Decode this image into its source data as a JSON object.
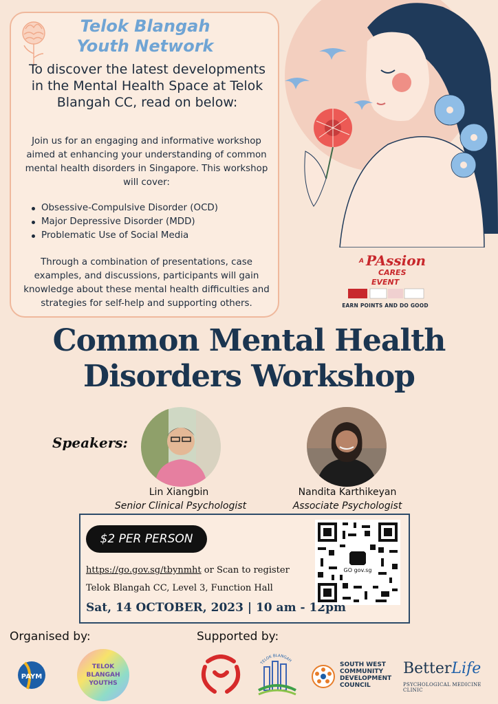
{
  "info": {
    "org_title": "Telok Blangah Youth Network",
    "heading": "To discover the latest developments in the Mental Health Space at Telok Blangah CC, read on below:",
    "intro": "Join us for an engaging and informative workshop aimed at enhancing your understanding of common mental health disorders in Singapore. This workshop will cover:",
    "topics": [
      "Obsessive-Compulsive Disorder (OCD)",
      "Major Depressive Disorder (MDD)",
      "Problematic Use of Social Media"
    ],
    "closing": "Through a combination of presentations, case examples, and discussions, participants will gain knowledge about these mental health difficulties and strategies for self-help and supporting others."
  },
  "passion": {
    "line1": "A",
    "line2": "PAssion",
    "line3": "CARES",
    "line4": "EVENT",
    "tagline": "EARN POINTS AND DO GOOD"
  },
  "title": {
    "line1": "Common Mental Health",
    "line2": "Disorders Workshop"
  },
  "speakers": {
    "label": "Speakers:",
    "list": [
      {
        "name": "Lin Xiangbin",
        "role": "Senior Clinical Psychologist"
      },
      {
        "name": "Nandita Karthikeyan",
        "role": "Associate Psychologist"
      }
    ]
  },
  "event": {
    "price": "$2 PER PERSON",
    "link": "https://go.gov.sg/tbynmht",
    "register_suffix": " or Scan to register",
    "venue": "Telok Blangah CC, Level 3, Function Hall",
    "datetime": "Sat, 14 OCTOBER, 2023 | 10 am - 12pm",
    "qr_label": "GO gov.sg"
  },
  "footer": {
    "organised_label": "Organised by:",
    "supported_label": "Supported by:",
    "paym": "PAYM",
    "tb_youths": [
      "TELOK",
      "BLANGAH",
      "YOUTHS"
    ],
    "tb_arc": "TELOK BLANGAH",
    "swcdc": [
      "SOUTH WEST",
      "COMMUNITY",
      "DEVELOPMENT",
      "COUNCIL"
    ],
    "betterlife_a": "Better",
    "betterlife_b": "Life",
    "betterlife_sub": "PSYCHOLOGICAL MEDICINE CLINIC"
  },
  "colors": {
    "background": "#f8e6d8",
    "navy": "#1b3550",
    "accent_blue": "#6fa4d4",
    "box_border": "#efb89c"
  }
}
